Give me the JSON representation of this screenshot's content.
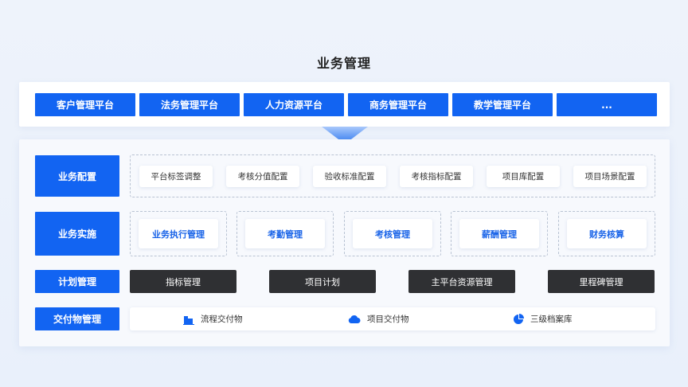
{
  "title": "业务管理",
  "platforms": [
    "客户管理平台",
    "法务管理平台",
    "人力资源平台",
    "商务管理平台",
    "教学管理平台",
    "..."
  ],
  "rows": {
    "config": {
      "label": "业务配置",
      "items": [
        "平台标签调整",
        "考核分值配置",
        "验收标准配置",
        "考核指标配置",
        "项目库配置",
        "项目场景配置"
      ]
    },
    "implement": {
      "label": "业务实施",
      "items": [
        "业务执行管理",
        "考勤管理",
        "考核管理",
        "薪酬管理",
        "财务核算"
      ]
    },
    "plan": {
      "label": "计划管理",
      "items": [
        "指标管理",
        "项目计划",
        "主平台资源管理",
        "里程碑管理"
      ]
    },
    "deliver": {
      "label": "交付物管理",
      "items": [
        {
          "label": "流程交付物",
          "icon": "building-icon"
        },
        {
          "label": "项目交付物",
          "icon": "cloud-icon"
        },
        {
          "label": "三级档案库",
          "icon": "pie-chart-icon"
        }
      ]
    }
  },
  "colors": {
    "accent": "#1264f2",
    "dark": "#2f3033",
    "accent_text": "#1a64e8"
  }
}
